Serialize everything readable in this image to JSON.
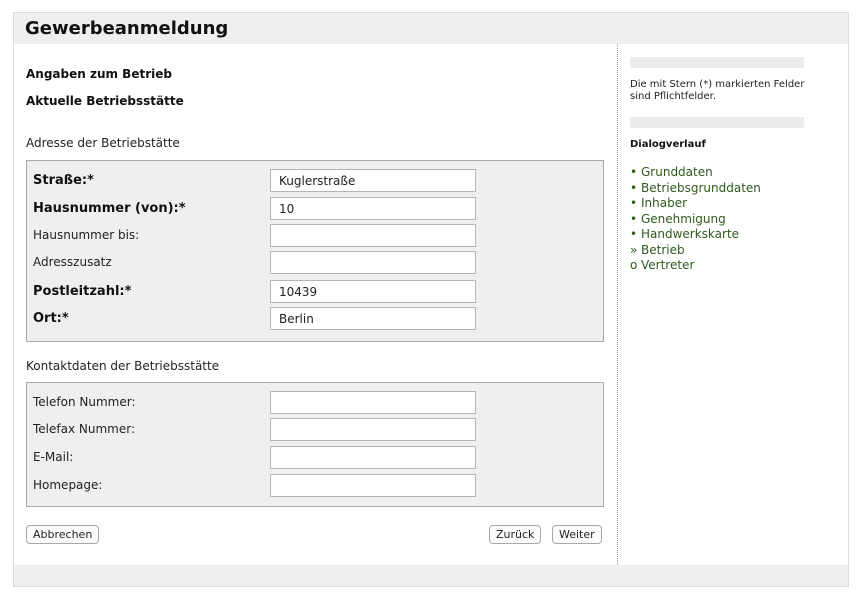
{
  "page": {
    "title": "Gewerbeanmeldung"
  },
  "main": {
    "heading_betrieb": "Angaben zum Betrieb",
    "heading_betriebsstaette": "Aktuelle Betriebsstätte",
    "address_section_label": "Adresse der Betriebstätte",
    "address_fields": [
      {
        "label": "Straße:*",
        "value": "Kuglerstraße",
        "required": true
      },
      {
        "label": "Hausnummer (von):*",
        "value": "10",
        "required": true
      },
      {
        "label": "Hausnummer bis:",
        "value": "",
        "required": false
      },
      {
        "label": "Adresszusatz",
        "value": "",
        "required": false
      },
      {
        "label": "Postleitzahl:*",
        "value": "10439",
        "required": true
      },
      {
        "label": "Ort:*",
        "value": "Berlin",
        "required": true
      }
    ],
    "contact_section_label": "Kontaktdaten der Betriebsstätte",
    "contact_fields": [
      {
        "label": "Telefon Nummer:",
        "value": ""
      },
      {
        "label": "Telefax Nummer:",
        "value": ""
      },
      {
        "label": "E-Mail:",
        "value": ""
      },
      {
        "label": "Homepage:",
        "value": ""
      }
    ],
    "buttons": {
      "cancel": "Abbrechen",
      "back": "Zurück",
      "next": "Weiter"
    }
  },
  "sidebar": {
    "required_note": "Die mit Stern (*) markierten Felder sind Pflichtfelder.",
    "dialog_heading": "Dialogverlauf",
    "dialog_steps": [
      {
        "marker": "•",
        "label": "Grunddaten",
        "status": "done"
      },
      {
        "marker": "•",
        "label": "Betriebsgrunddaten",
        "status": "done"
      },
      {
        "marker": "•",
        "label": "Inhaber",
        "status": "done"
      },
      {
        "marker": "•",
        "label": "Genehmigung",
        "status": "done"
      },
      {
        "marker": "•",
        "label": "Handwerkskarte",
        "status": "done"
      },
      {
        "marker": "»",
        "label": "Betrieb",
        "status": "current"
      },
      {
        "marker": "o",
        "label": "Vertreter",
        "status": "open"
      }
    ]
  }
}
